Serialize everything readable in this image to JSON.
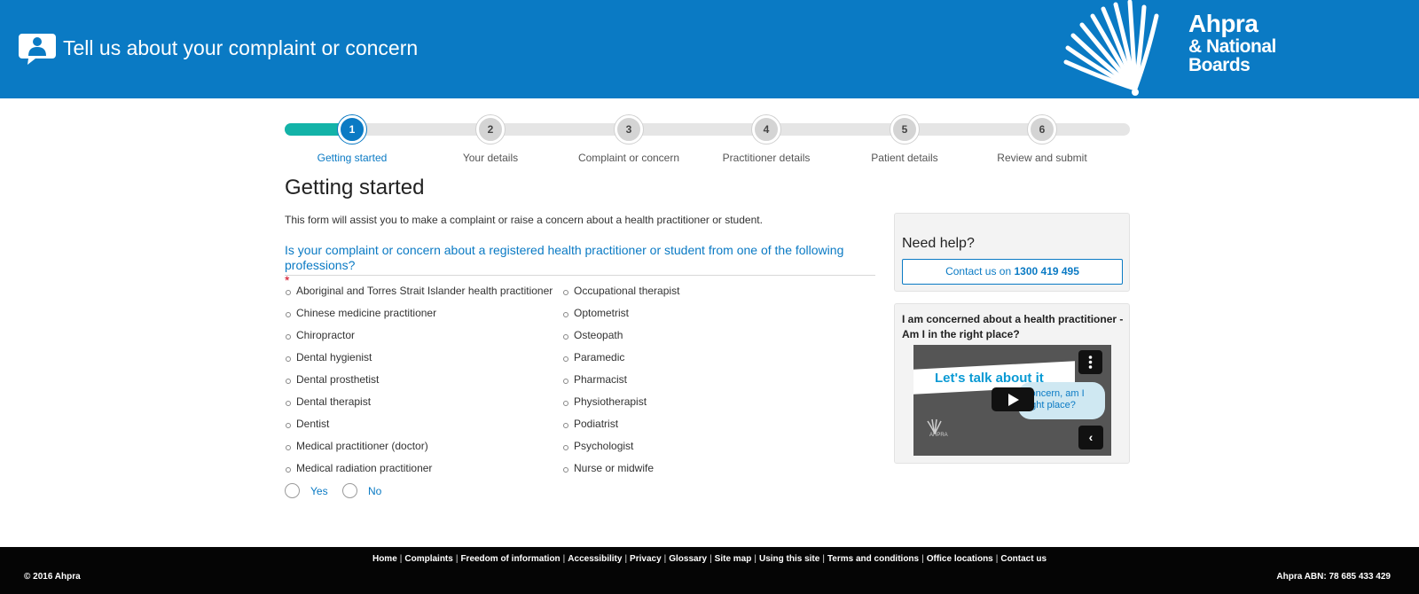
{
  "header": {
    "title": "Tell us about your complaint or concern",
    "icon": "person-speech-bubble-icon",
    "logo": {
      "line1": "Ahpra",
      "line2": "& National",
      "line3": "Boards"
    },
    "color": "#0a7ac4"
  },
  "progress": {
    "current_step": 1,
    "fill_fraction": 0.085,
    "steps": [
      {
        "number": "1",
        "label": "Getting started"
      },
      {
        "number": "2",
        "label": "Your details"
      },
      {
        "number": "3",
        "label": "Complaint or concern"
      },
      {
        "number": "4",
        "label": "Practitioner details"
      },
      {
        "number": "5",
        "label": "Patient details"
      },
      {
        "number": "6",
        "label": "Review and submit"
      }
    ]
  },
  "main": {
    "title": "Getting started",
    "intro": "This form will assist you to make a complaint or raise a concern about a health practitioner or student.",
    "question": "Is your complaint or concern about a registered health practitioner or student from one of the following professions?",
    "required_marker": "*",
    "professions_col1": [
      "Aboriginal and Torres Strait Islander health practitioner",
      "Chinese medicine practitioner",
      "Chiropractor",
      "Dental hygienist",
      "Dental prosthetist",
      "Dental therapist",
      "Dentist",
      "Medical practitioner (doctor)",
      "Medical radiation practitioner"
    ],
    "professions_col2": [
      "Occupational therapist",
      "Optometrist",
      "Osteopath",
      "Paramedic",
      "Pharmacist",
      "Physiotherapist",
      "Podiatrist",
      "Psychologist",
      "Nurse or midwife"
    ],
    "options": {
      "yes": "Yes",
      "no": "No"
    }
  },
  "sidebar": {
    "help_title": "Need help?",
    "contact_prefix": "Contact us on",
    "contact_phone": "1300 419 495",
    "video_title": "I am concerned about a health practitioner - Am I in the right place?",
    "video_banner": "Let's talk about it",
    "video_bubble": "concern, am I right place?",
    "video_logo": "AHPRA"
  },
  "footer": {
    "links": [
      "Home",
      "Complaints",
      "Freedom of information",
      "Accessibility",
      "Privacy",
      "Glossary",
      "Site map",
      "Using this site",
      "Terms and conditions",
      "Office locations",
      "Contact us"
    ],
    "copyright": "© 2016 Ahpra",
    "abn": "Ahpra ABN: 78 685 433 429"
  }
}
